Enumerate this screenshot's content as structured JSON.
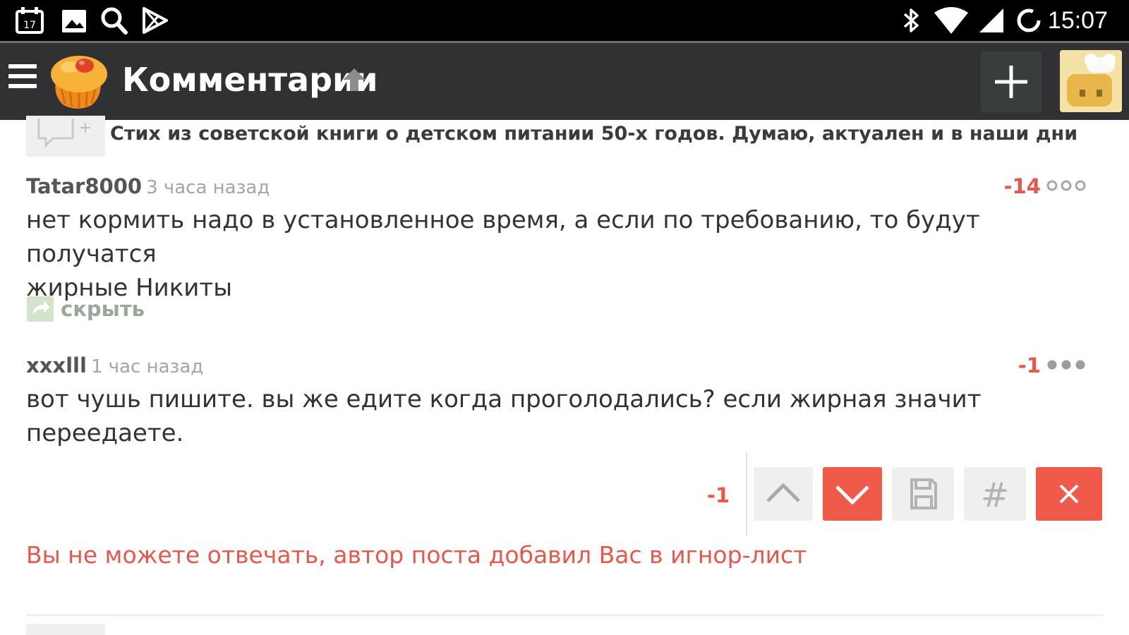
{
  "status_bar": {
    "time": "15:07",
    "calendar_day": "17",
    "icons": [
      "calendar-notification-icon",
      "gallery-icon",
      "search-icon",
      "play-store-icon",
      "bluetooth-icon",
      "wifi-icon",
      "cellular-signal-icon",
      "sync-icon"
    ]
  },
  "app_bar": {
    "title": "Комментарии",
    "icons": [
      "menu-icon",
      "app-logo",
      "scroll-up-icon",
      "add-icon",
      "user-avatar"
    ]
  },
  "post": {
    "title": "Стих из советской книги о детском питании 50-х годов. Думаю, актуален и в наши дни",
    "add_comment_glyph": "+"
  },
  "comments": [
    {
      "author": "Tatar8000",
      "time": "3 часа назад",
      "rating": "-14",
      "text_lines": [
        "нет кормить надо в установленное время, а если по требованию, то будут получатся",
        "жирные Никиты"
      ],
      "hide_label": "скрыть"
    },
    {
      "author": "xxxlll",
      "time": "1 час назад",
      "rating": "-1",
      "text": "вот чушь пишите. вы же едите когда проголодались? если жирная значит переедаете."
    }
  ],
  "vote_bar": {
    "rating": "-1",
    "buttons": [
      "upvote-button",
      "downvote-button",
      "save-button",
      "link-button",
      "close-button"
    ],
    "hash_glyph": "#"
  },
  "notice": "Вы не можете отвечать, автор поста добавил Вас в игнор-лист",
  "colors": {
    "status_bar": "#000000",
    "app_bar": "#2f3132",
    "negative": "#e8584a",
    "button_red": "#f05a4b",
    "button_gray": "#eef0ee"
  }
}
